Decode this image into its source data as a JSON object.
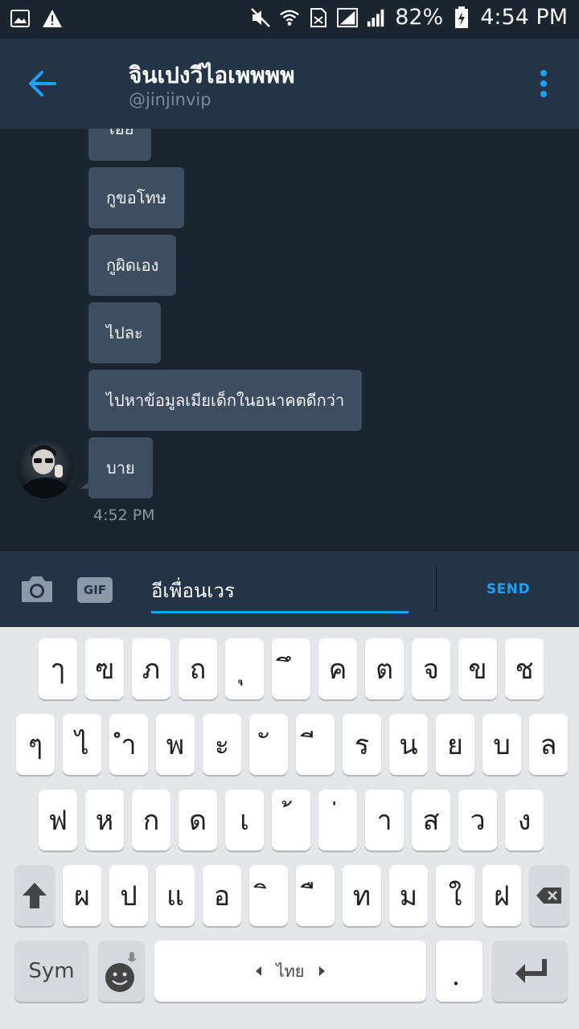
{
  "status_bar": {
    "left_icons": [
      "image-icon",
      "warning-icon"
    ],
    "right_icons": [
      "mute-icon",
      "wifi-icon",
      "sim-icon",
      "signal-icon",
      "signal-icon-2",
      "battery-icon"
    ],
    "battery": "82%",
    "time": "4:54 PM"
  },
  "header": {
    "title": "จินเปงวีไอเพพพพ",
    "handle": "@jinjinvip",
    "back_icon": "arrow-left-icon",
    "menu_icon": "more-vertical-icon"
  },
  "chat": {
    "messages": [
      {
        "text": "โอ๋ย"
      },
      {
        "text": "กูขอโทษ"
      },
      {
        "text": "กูผิดเอง"
      },
      {
        "text": "ไปละ"
      },
      {
        "text": "ไปหาข้อมูลเมียเด็กในอนาคตดีกว่า"
      },
      {
        "text": "บาย"
      }
    ],
    "timestamp": "4:52 PM"
  },
  "composer": {
    "camera_icon": "camera-icon",
    "gif_label": "GIF",
    "input_value": "อีเพื่อนเวร",
    "send_label": "SEND"
  },
  "keyboard": {
    "row1": [
      "ๅ",
      "ฃ",
      "ภ",
      "ถ",
      "ุ",
      "ึ",
      "ค",
      "ต",
      "จ",
      "ข",
      "ช"
    ],
    "row2": [
      "ๆ",
      "ไ",
      "ำ",
      "พ",
      "ะ",
      "ั",
      "ี",
      "ร",
      "น",
      "ย",
      "บ",
      "ล"
    ],
    "row3": [
      "ฟ",
      "ห",
      "ก",
      "ด",
      "เ",
      "้",
      "่",
      "า",
      "ส",
      "ว",
      "ง"
    ],
    "row4": [
      "ผ",
      "ป",
      "แ",
      "อ",
      "ิ",
      "ื",
      "ท",
      "ม",
      "ใ",
      "ฝ"
    ],
    "sym_label": "Sym",
    "space_label": "ไทย",
    "period": "ฺ",
    "accent": "#1da1f2"
  }
}
